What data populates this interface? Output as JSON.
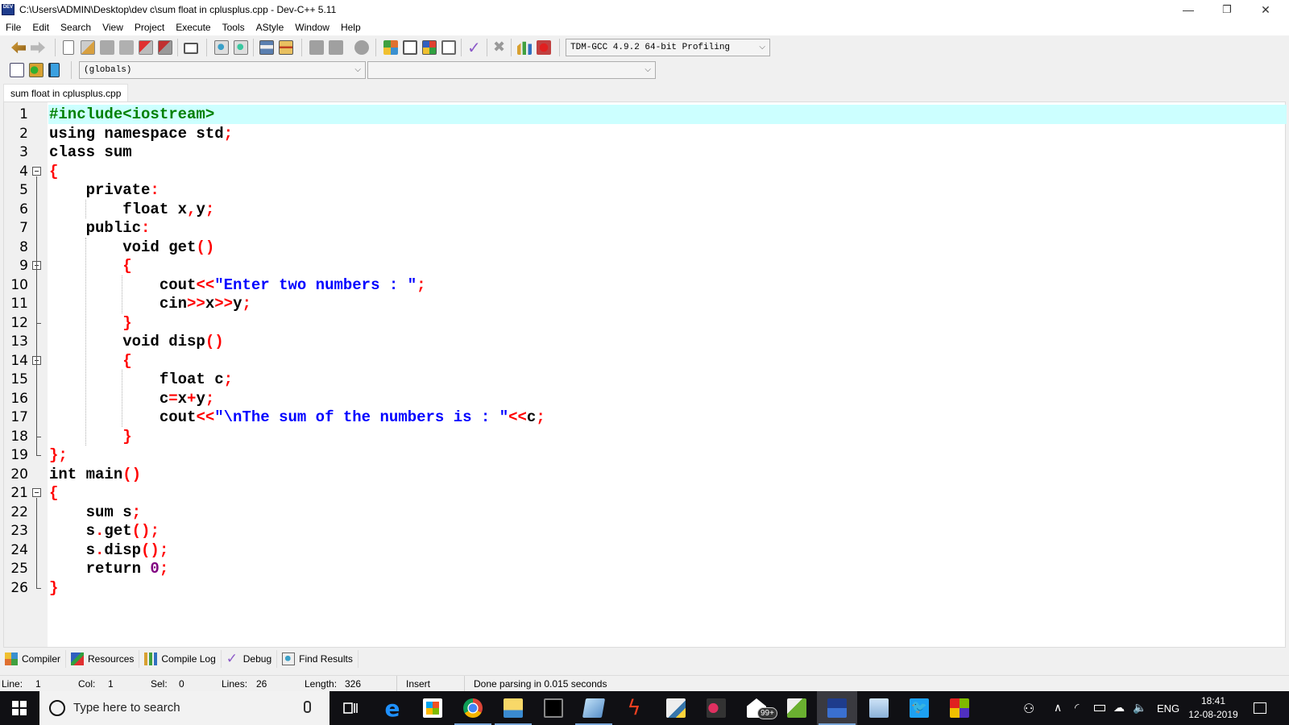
{
  "window": {
    "title": "C:\\Users\\ADMIN\\Desktop\\dev c\\sum float in cplusplus.cpp - Dev-C++ 5.11",
    "app_icon_label": "DEV",
    "minimize": "—",
    "restore": "❐",
    "close": "✕"
  },
  "menu": [
    "File",
    "Edit",
    "Search",
    "View",
    "Project",
    "Execute",
    "Tools",
    "AStyle",
    "Window",
    "Help"
  ],
  "toolbar": {
    "compiler_select": "TDM-GCC 4.9.2 64-bit Profiling",
    "globals_select": "(globals)",
    "members_select": ""
  },
  "editor": {
    "tab_label": "sum float in cplusplus.cpp",
    "lines": [
      {
        "n": "1",
        "tokens": [
          {
            "t": "#include<iostream>",
            "c": "pp"
          }
        ]
      },
      {
        "n": "2",
        "tokens": [
          {
            "t": "using namespace std",
            "c": ""
          },
          {
            "t": ";",
            "c": "sym"
          }
        ]
      },
      {
        "n": "3",
        "tokens": [
          {
            "t": "class sum",
            "c": ""
          }
        ]
      },
      {
        "n": "4",
        "tokens": [
          {
            "t": "{",
            "c": "sym"
          }
        ]
      },
      {
        "n": "5",
        "tokens": [
          {
            "t": "    private",
            "c": ""
          },
          {
            "t": ":",
            "c": "sym"
          }
        ]
      },
      {
        "n": "6",
        "tokens": [
          {
            "t": "        float x",
            "c": ""
          },
          {
            "t": ",",
            "c": "sym"
          },
          {
            "t": "y",
            "c": ""
          },
          {
            "t": ";",
            "c": "sym"
          }
        ]
      },
      {
        "n": "7",
        "tokens": [
          {
            "t": "    public",
            "c": ""
          },
          {
            "t": ":",
            "c": "sym"
          }
        ]
      },
      {
        "n": "8",
        "tokens": [
          {
            "t": "        void get",
            "c": ""
          },
          {
            "t": "()",
            "c": "sym"
          }
        ]
      },
      {
        "n": "9",
        "tokens": [
          {
            "t": "        ",
            "c": ""
          },
          {
            "t": "{",
            "c": "sym"
          }
        ]
      },
      {
        "n": "10",
        "tokens": [
          {
            "t": "            cout",
            "c": ""
          },
          {
            "t": "<<",
            "c": "sym"
          },
          {
            "t": "\"Enter two numbers : \"",
            "c": "str"
          },
          {
            "t": ";",
            "c": "sym"
          }
        ]
      },
      {
        "n": "11",
        "tokens": [
          {
            "t": "            cin",
            "c": ""
          },
          {
            "t": ">>",
            "c": "sym"
          },
          {
            "t": "x",
            "c": ""
          },
          {
            "t": ">>",
            "c": "sym"
          },
          {
            "t": "y",
            "c": ""
          },
          {
            "t": ";",
            "c": "sym"
          }
        ]
      },
      {
        "n": "12",
        "tokens": [
          {
            "t": "        ",
            "c": ""
          },
          {
            "t": "}",
            "c": "sym"
          }
        ]
      },
      {
        "n": "13",
        "tokens": [
          {
            "t": "        void disp",
            "c": ""
          },
          {
            "t": "()",
            "c": "sym"
          }
        ]
      },
      {
        "n": "14",
        "tokens": [
          {
            "t": "        ",
            "c": ""
          },
          {
            "t": "{",
            "c": "sym"
          }
        ]
      },
      {
        "n": "15",
        "tokens": [
          {
            "t": "            float c",
            "c": ""
          },
          {
            "t": ";",
            "c": "sym"
          }
        ]
      },
      {
        "n": "16",
        "tokens": [
          {
            "t": "            c",
            "c": ""
          },
          {
            "t": "=",
            "c": "sym"
          },
          {
            "t": "x",
            "c": ""
          },
          {
            "t": "+",
            "c": "sym"
          },
          {
            "t": "y",
            "c": ""
          },
          {
            "t": ";",
            "c": "sym"
          }
        ]
      },
      {
        "n": "17",
        "tokens": [
          {
            "t": "            cout",
            "c": ""
          },
          {
            "t": "<<",
            "c": "sym"
          },
          {
            "t": "\"\\nThe sum of the numbers is : \"",
            "c": "str"
          },
          {
            "t": "<<",
            "c": "sym"
          },
          {
            "t": "c",
            "c": ""
          },
          {
            "t": ";",
            "c": "sym"
          }
        ]
      },
      {
        "n": "18",
        "tokens": [
          {
            "t": "        ",
            "c": ""
          },
          {
            "t": "}",
            "c": "sym"
          }
        ]
      },
      {
        "n": "19",
        "tokens": [
          {
            "t": "};",
            "c": "sym"
          }
        ]
      },
      {
        "n": "20",
        "tokens": [
          {
            "t": "int main",
            "c": ""
          },
          {
            "t": "()",
            "c": "sym"
          }
        ]
      },
      {
        "n": "21",
        "tokens": [
          {
            "t": "{",
            "c": "sym"
          }
        ]
      },
      {
        "n": "22",
        "tokens": [
          {
            "t": "    sum s",
            "c": ""
          },
          {
            "t": ";",
            "c": "sym"
          }
        ]
      },
      {
        "n": "23",
        "tokens": [
          {
            "t": "    s",
            "c": ""
          },
          {
            "t": ".",
            "c": "sym"
          },
          {
            "t": "get",
            "c": ""
          },
          {
            "t": "();",
            "c": "sym"
          }
        ]
      },
      {
        "n": "24",
        "tokens": [
          {
            "t": "    s",
            "c": ""
          },
          {
            "t": ".",
            "c": "sym"
          },
          {
            "t": "disp",
            "c": ""
          },
          {
            "t": "();",
            "c": "sym"
          }
        ]
      },
      {
        "n": "25",
        "tokens": [
          {
            "t": "    return ",
            "c": ""
          },
          {
            "t": "0",
            "c": "num"
          },
          {
            "t": ";",
            "c": "sym"
          }
        ]
      },
      {
        "n": "26",
        "tokens": [
          {
            "t": "}",
            "c": "sym"
          }
        ]
      }
    ]
  },
  "bottom_tabs": [
    {
      "label": "Compiler",
      "icon": "compiler-icon"
    },
    {
      "label": "Resources",
      "icon": "resources-icon"
    },
    {
      "label": "Compile Log",
      "icon": "compile-log-icon"
    },
    {
      "label": "Debug",
      "icon": "debug-icon"
    },
    {
      "label": "Find Results",
      "icon": "find-results-icon"
    }
  ],
  "status": {
    "line_label": "Line:",
    "line_value": "1",
    "col_label": "Col:",
    "col_value": "1",
    "sel_label": "Sel:",
    "sel_value": "0",
    "lines_label": "Lines:",
    "lines_value": "26",
    "length_label": "Length:",
    "length_value": "326",
    "mode": "Insert",
    "message": "Done parsing in 0.015 seconds"
  },
  "taskbar": {
    "search_placeholder": "Type here to search",
    "mail_badge": "99+",
    "language": "ENG",
    "time": "18:41",
    "date": "12-08-2019"
  },
  "colors": {
    "current_line": "#ccffff",
    "symbol": "#ff0000",
    "string": "#0000ff",
    "preprocessor": "#008000",
    "number": "#800080"
  }
}
